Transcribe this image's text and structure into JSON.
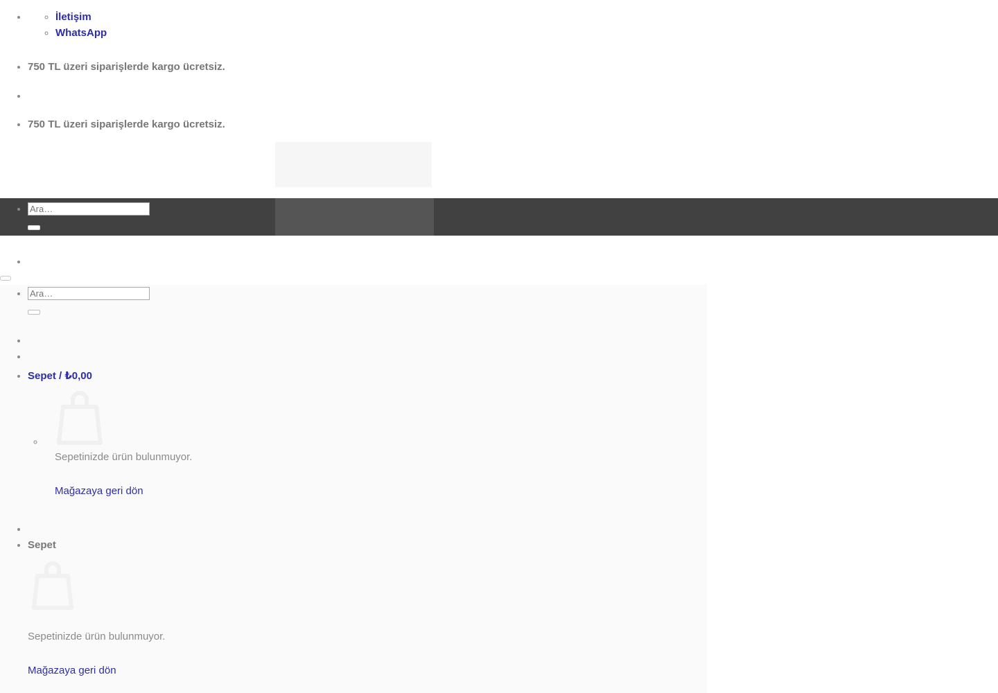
{
  "nav": {
    "contact_label": "İletişim",
    "whatsapp_label": "WhatsApp"
  },
  "notices": {
    "shipping_notice": "750 TL üzeri siparişlerde kargo ücretsiz.",
    "shipping_notice_repeat": "750 TL üzeri siparişlerde kargo ücretsiz."
  },
  "search": {
    "placeholder": "Ara…",
    "value": "",
    "submit_label": "",
    "placeholder_secondary": "Ara…",
    "value_secondary": "",
    "submit_label_secondary": ""
  },
  "toggles": {
    "menu_toggle_label": "",
    "search_toggle_label": ""
  },
  "mini_cart": {
    "link_label": "Sepet / ₺0,00",
    "bag_icon": "shopping-bag-icon",
    "empty_text": "Sepetinizde ürün bulunmuyor.",
    "return_link": "Mağazaya geri dön"
  },
  "cart_panel": {
    "title": "Sepet",
    "bag_icon": "shopping-bag-icon",
    "empty_text": "Sepetinizde ürün bulunmuyor.",
    "return_link": "Mağazaya geri dön"
  },
  "colors": {
    "link": "#2d2da6",
    "muted_text": "#777777",
    "dark_strip": "#414141",
    "dark_strip_inner": "#555555",
    "faint_panel": "#fafafa",
    "page_background": "#ffffff"
  }
}
